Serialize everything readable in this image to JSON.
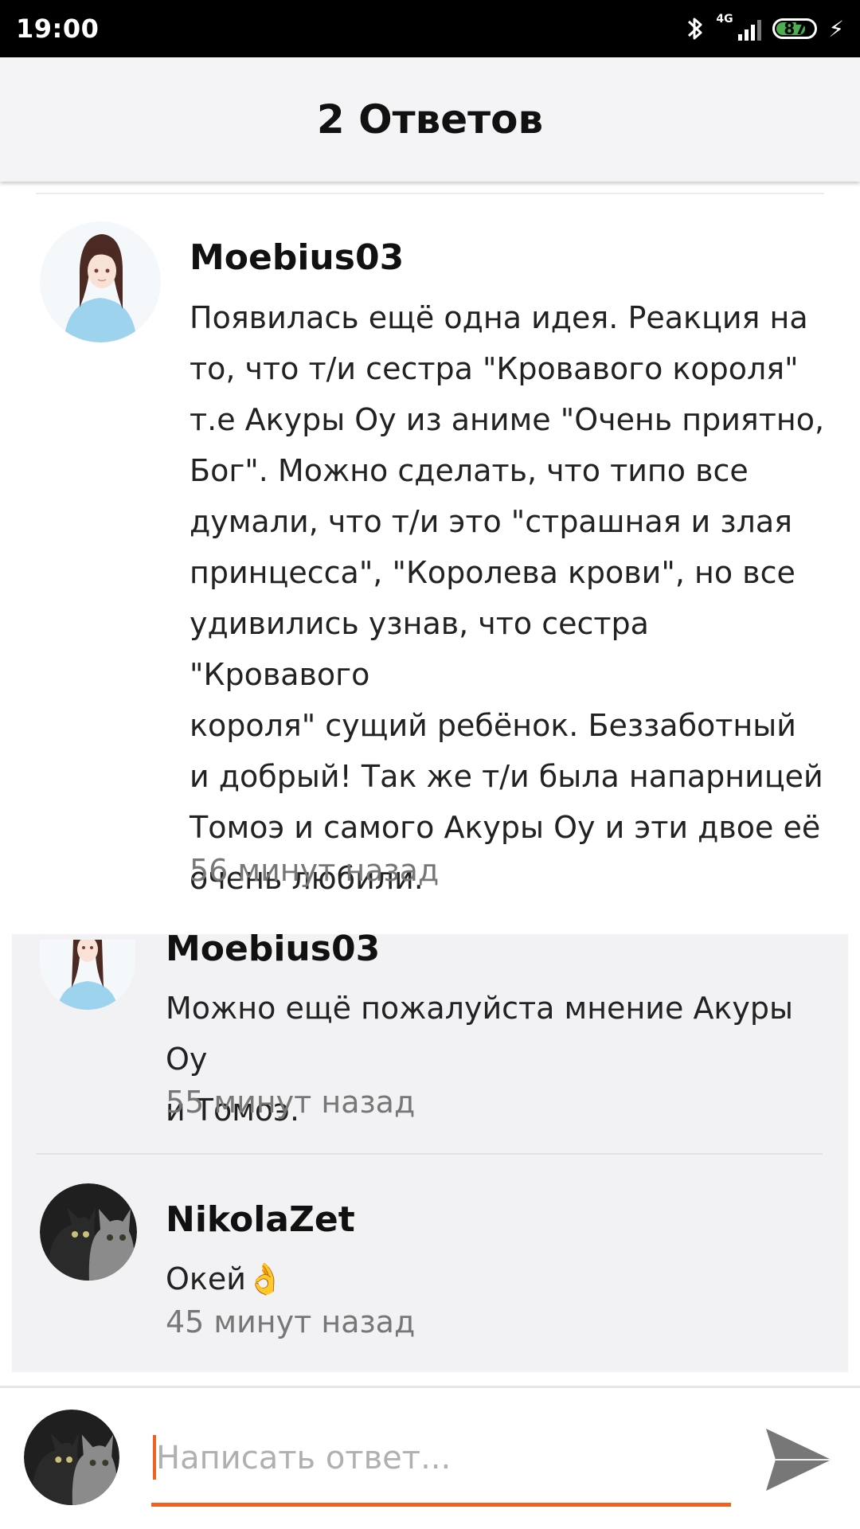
{
  "status_bar": {
    "time": "19:00",
    "network": "4G",
    "battery": "87",
    "icons": [
      "bluetooth-icon",
      "signal-icon",
      "battery-icon",
      "charging-icon"
    ]
  },
  "header": {
    "title": "2 Ответов"
  },
  "main_comment": {
    "username": "Moebius03",
    "text": "Появилась ещё одна идея. Реакция на\nто, что т/и сестра \"Кровавого короля\"\nт.е Акуры Оу из аниме \"Очень приятно,\nБог\". Можно сделать, что типо все\nдумали, что т/и это \"страшная и злая\nпринцесса\", \"Королева крови\", но все\nудивились узнав, что сестра \"Кровавого\nкороля\" сущий ребёнок. Беззаботный\nи добрый! Так же т/и была напарницей\nТомоэ и самого Акуры Оу и эти двое её\nочень любили.",
    "time": "56 минут назад"
  },
  "replies": [
    {
      "username": "Moebius03",
      "text": "Можно ещё пожалуйста мнение Акуры Оу\nи Томоэ.",
      "time": "55 минут назад"
    },
    {
      "username": "NikolaZet",
      "text": "Окей👌",
      "time": "45 минут назад"
    }
  ],
  "footer": {
    "placeholder": "Написать ответ...",
    "value": ""
  },
  "colors": {
    "accent": "#f0621f",
    "header_bg": "#f4f4f6",
    "reply_bg": "#f2f2f4",
    "secondary_text": "#777777"
  }
}
